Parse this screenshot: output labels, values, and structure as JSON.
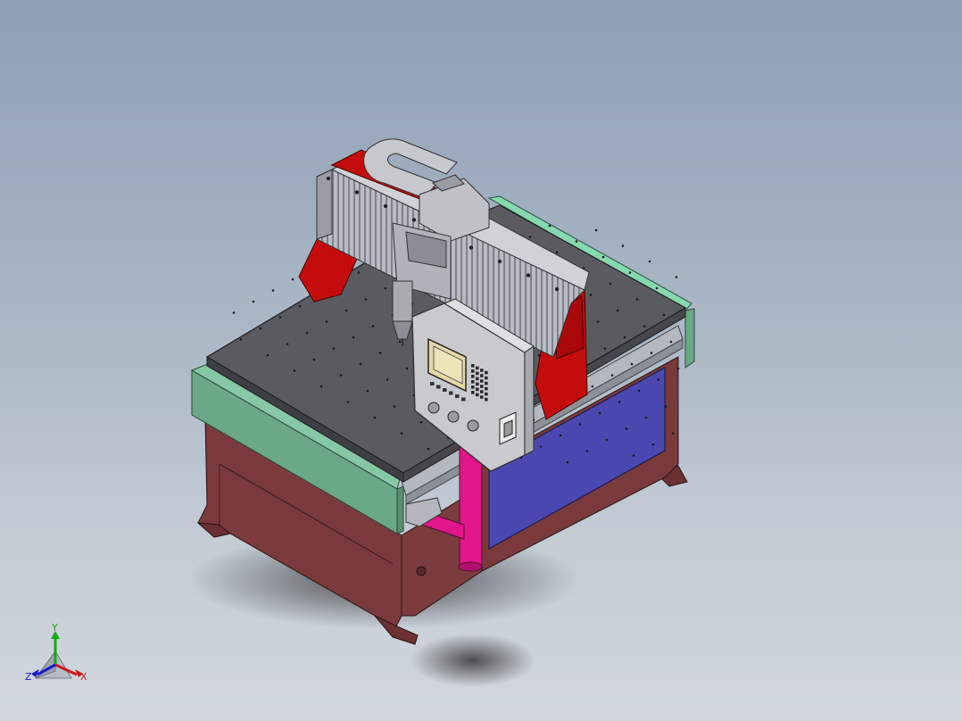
{
  "viewport": {
    "background_top": "#8da0b4",
    "background_bottom": "#d2d7de"
  },
  "model": {
    "frame_color": "#7a3a3a",
    "table_color": "#56575c",
    "gantry_color": "#c40c0c",
    "cover_color": "#6aae8c",
    "panel_color": "#4a48b0",
    "pipe_color": "#e0168a",
    "controller_color": "#c8c8cc"
  },
  "triad": {
    "x_label": "X",
    "y_label": "Y",
    "z_label": "Z",
    "x_color": "#d01818",
    "y_color": "#18a818",
    "z_color": "#1818d0"
  }
}
